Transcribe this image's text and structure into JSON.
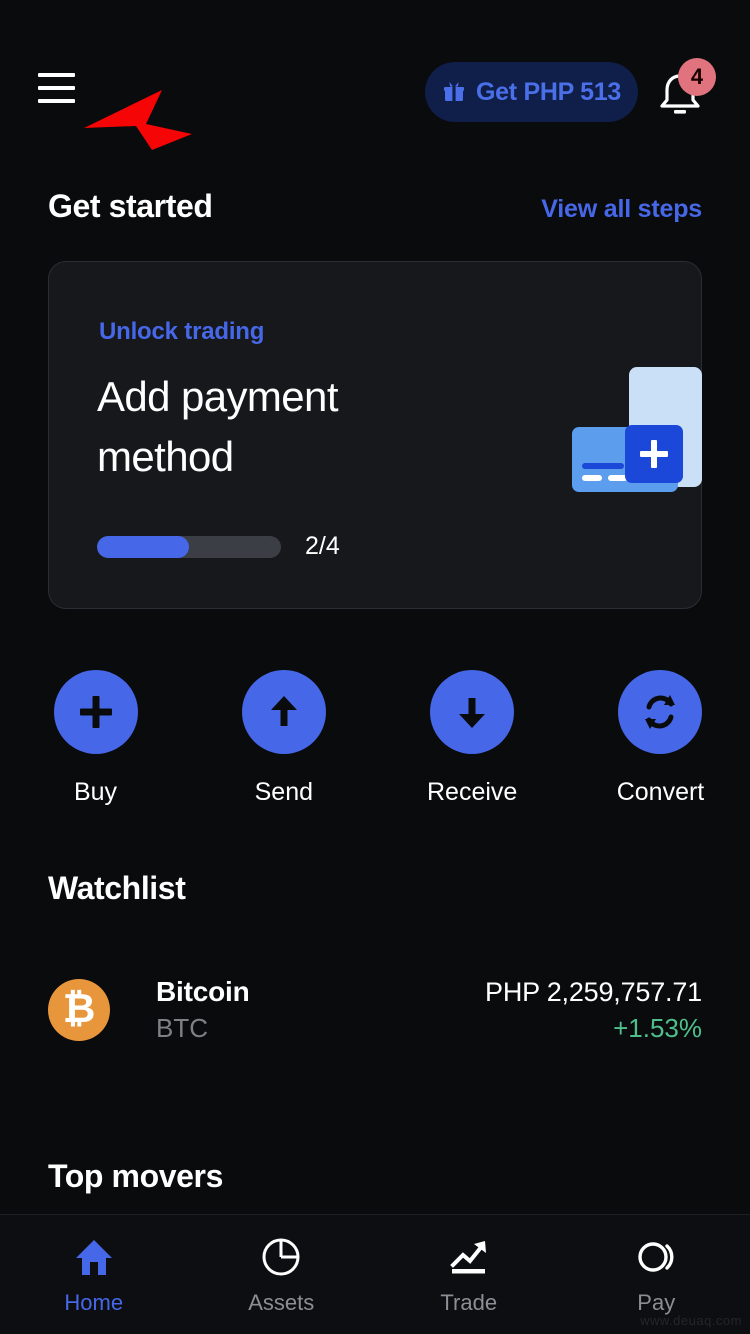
{
  "header": {
    "menu_icon": "hamburger-menu-icon",
    "annotation_arrow": "red-arrow-annotation",
    "promo_button": {
      "icon": "gift-icon",
      "label": "Get PHP 513"
    },
    "notifications": {
      "icon": "bell-icon",
      "badge_count": "4"
    }
  },
  "get_started": {
    "title": "Get started",
    "view_all_link": "View all steps"
  },
  "promo_card": {
    "eyebrow": "Unlock trading",
    "title": "Add payment method",
    "illustration": "add-card-illustration",
    "progress_label": "2/4",
    "progress_current": 2,
    "progress_total": 4,
    "progress_percent": 50
  },
  "quick_actions": [
    {
      "label": "Buy",
      "icon": "plus-icon"
    },
    {
      "label": "Send",
      "icon": "arrow-up-icon"
    },
    {
      "label": "Receive",
      "icon": "arrow-down-icon"
    },
    {
      "label": "Convert",
      "icon": "refresh-cycle-icon"
    }
  ],
  "watchlist": {
    "title": "Watchlist",
    "assets": [
      {
        "name": "Bitcoin",
        "ticker": "BTC",
        "symbol": "₿",
        "price": "PHP 2,259,757.71",
        "change": "+1.53%",
        "logo_color": "#e8963c",
        "change_color": "#4fbf8c"
      }
    ]
  },
  "top_movers": {
    "title": "Top movers"
  },
  "bottom_nav": {
    "items": [
      {
        "label": "Home",
        "icon": "home-icon",
        "active": true
      },
      {
        "label": "Assets",
        "icon": "pie-chart-icon",
        "active": false
      },
      {
        "label": "Trade",
        "icon": "trending-up-icon",
        "active": false
      },
      {
        "label": "Pay",
        "icon": "pay-signal-icon",
        "active": false
      }
    ]
  },
  "watermark": "www.deuaq.com",
  "colors": {
    "background": "#0a0b0d",
    "card": "#16181c",
    "accent_blue": "#4668e8",
    "positive_green": "#4fbf8c",
    "badge_red": "#e0737d",
    "bitcoin_orange": "#e8963c"
  }
}
